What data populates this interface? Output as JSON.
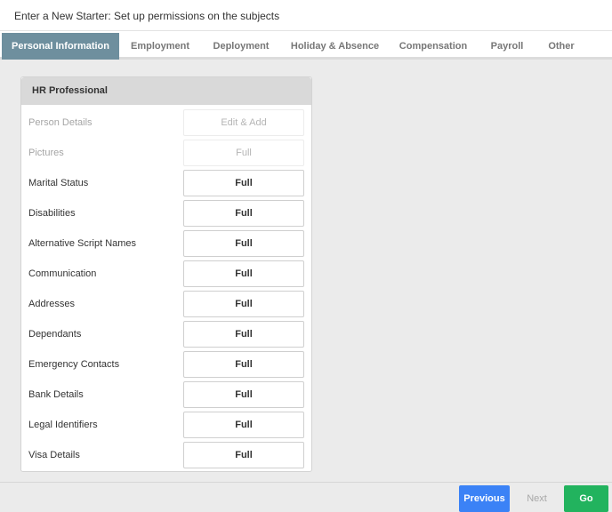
{
  "header": {
    "title": "Enter a New Starter: Set up permissions on the subjects"
  },
  "tabs": [
    {
      "label": "Personal Information",
      "active": true
    },
    {
      "label": "Employment"
    },
    {
      "label": "Deployment"
    },
    {
      "label": "Holiday & Absence"
    },
    {
      "label": "Compensation"
    },
    {
      "label": "Payroll"
    },
    {
      "label": "Other"
    }
  ],
  "panel": {
    "title": "HR Professional",
    "rows": [
      {
        "label": "Person Details",
        "value": "Edit & Add",
        "disabled": true
      },
      {
        "label": "Pictures",
        "value": "Full",
        "disabled": true
      },
      {
        "label": "Marital Status",
        "value": "Full"
      },
      {
        "label": "Disabilities",
        "value": "Full"
      },
      {
        "label": "Alternative Script Names",
        "value": "Full"
      },
      {
        "label": "Communication",
        "value": "Full"
      },
      {
        "label": "Addresses",
        "value": "Full"
      },
      {
        "label": "Dependants",
        "value": "Full"
      },
      {
        "label": "Emergency Contacts",
        "value": "Full"
      },
      {
        "label": "Bank Details",
        "value": "Full"
      },
      {
        "label": "Legal Identifiers",
        "value": "Full"
      },
      {
        "label": "Visa Details",
        "value": "Full"
      }
    ]
  },
  "footer": {
    "previous_label": "Previous",
    "next_label": "Next",
    "go_label": "Go"
  },
  "colors": {
    "active_tab": "#6e8f9e",
    "previous_button": "#3b82f6",
    "go_button": "#22b35e"
  }
}
